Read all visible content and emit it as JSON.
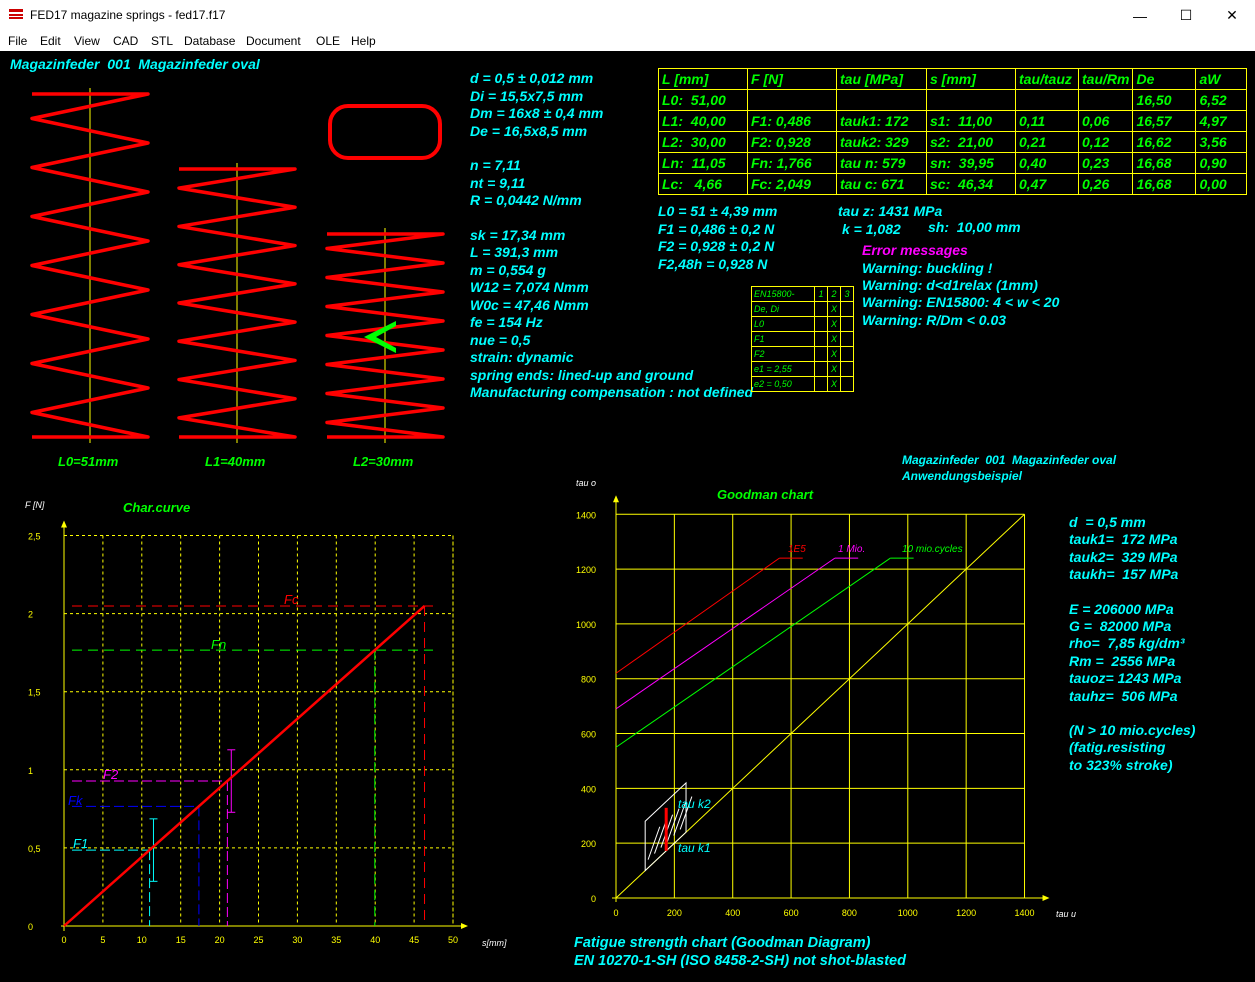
{
  "window": {
    "title": "FED17  magazine springs  -  fed17.f17",
    "minimize_glyph": "—",
    "maximize_glyph": "☐",
    "close_glyph": "✕"
  },
  "menu": {
    "items": [
      "File",
      "Edit",
      "View",
      "CAD",
      "STL",
      "Database",
      "Document",
      "OLE",
      "Help"
    ]
  },
  "header": {
    "spring_name": "Magazinfeder  001  Magazinfeder oval"
  },
  "spring_views": {
    "labels": [
      "L0=51mm",
      "L1=40mm",
      "L2=30mm"
    ]
  },
  "params_left": [
    "d = 0,5 ± 0,012 mm",
    "Di = 15,5x7,5 mm",
    "Dm = 16x8 ± 0,4 mm",
    "De = 16,5x8,5 mm",
    "",
    "n = 7,11",
    "nt = 9,11",
    "R = 0,0442 N/mm",
    "",
    "sk = 17,34 mm",
    "L = 391,3 mm",
    "m = 0,554 g",
    "W12 = 7,074 Nmm",
    "W0c = 47,46 Nmm",
    "fe = 154 Hz",
    "nue = 0,5",
    "strain: dynamic",
    "spring ends: lined-up and ground",
    "Manufacturing compensation : not defined"
  ],
  "results_table": {
    "headers": [
      "L [mm]",
      "F [N]",
      "tau [MPa]",
      "s [mm]",
      "tau/tauz",
      "tau/Rm",
      "De",
      "aW"
    ],
    "rows": [
      [
        "L0:  51,00",
        "",
        "",
        "",
        "",
        "",
        "16,50",
        "6,52"
      ],
      [
        "L1:  40,00",
        "F1: 0,486",
        "tauk1: 172",
        "s1:  11,00",
        "0,11",
        "0,06",
        "16,57",
        "4,97"
      ],
      [
        "L2:  30,00",
        "F2: 0,928",
        "tauk2: 329",
        "s2:  21,00",
        "0,21",
        "0,12",
        "16,62",
        "3,56"
      ],
      [
        "Ln:  11,05",
        "Fn: 1,766",
        "tau n: 579",
        "sn:  39,95",
        "0,40",
        "0,23",
        "16,68",
        "0,90"
      ],
      [
        "Lc:   4,66",
        "Fc: 2,049",
        "tau c: 671",
        "sc:  46,34",
        "0,47",
        "0,26",
        "16,68",
        "0,00"
      ]
    ]
  },
  "tolerances": {
    "l0": "L0 = 51 ± 4,39 mm",
    "f1": "F1 = 0,486 ± 0,2 N",
    "f2": "F2 = 0,928 ± 0,2 N",
    "f248": "F2,48h = 0,928 N",
    "tauz": "tau z: 1431 MPa",
    "k": "k = 1,082",
    "sh": "sh:  10,00 mm"
  },
  "en15800": {
    "header": [
      "EN15800-",
      "1",
      "2",
      "3"
    ],
    "rows": [
      [
        "De, Di",
        "",
        "X",
        ""
      ],
      [
        "L0",
        "",
        "X",
        ""
      ],
      [
        "F1",
        "",
        "X",
        ""
      ],
      [
        "F2",
        "",
        "X",
        ""
      ],
      [
        "e1 = 2,55",
        "",
        "X",
        ""
      ],
      [
        "e2 = 0,50",
        "",
        "X",
        ""
      ]
    ]
  },
  "errors": {
    "title": "Error messages",
    "items": [
      "Warning: buckling !",
      "Warning: d<d1relax (1mm)",
      "Warning: EN15800: 4 < w < 20",
      "Warning: R/Dm < 0.03"
    ]
  },
  "char_curve": {
    "title": "Char.curve",
    "ylabel": "F [N]",
    "xlabel": "s[mm]",
    "xticks": [
      "0",
      "5",
      "10",
      "15",
      "20",
      "25",
      "30",
      "35",
      "40",
      "45",
      "50"
    ],
    "yticks": [
      "0",
      "0,5",
      "1",
      "1,5",
      "2",
      "2,5"
    ],
    "labels": {
      "fc": "Fc",
      "fn": "Fn",
      "f2": "F2",
      "fk": "Fk",
      "f1": "F1"
    }
  },
  "chart_data": [
    {
      "type": "line",
      "title": "Char.curve",
      "xlabel": "s[mm]",
      "ylabel": "F [N]",
      "xlim": [
        0,
        50
      ],
      "ylim": [
        0,
        2.5
      ],
      "series": [
        {
          "values": [
            [
              0,
              0
            ],
            [
              46.34,
              2.049
            ]
          ]
        }
      ],
      "markers": {
        "F1": [
          11.0,
          0.486
        ],
        "F2": [
          21.0,
          0.928
        ],
        "Fk": [
          17.34,
          0.766
        ],
        "Fn": [
          39.95,
          1.766
        ],
        "Fc": [
          46.34,
          2.049
        ]
      },
      "tolerance_bars": {
        "F1": [
          11.0,
          0.286,
          0.686
        ],
        "F2": [
          21.0,
          0.728,
          1.128
        ]
      }
    },
    {
      "type": "line",
      "title": "Goodman chart",
      "xlabel": "tau u",
      "ylabel": "tau o",
      "xlim": [
        0,
        1400
      ],
      "ylim": [
        0,
        1400
      ],
      "series": [
        {
          "name": "1E5",
          "values": [
            [
              0,
              820
            ],
            [
              560,
              1240
            ]
          ]
        },
        {
          "name": "1 Mio.",
          "values": [
            [
              0,
              690
            ],
            [
              750,
              1240
            ]
          ]
        },
        {
          "name": "10 mio.cycles",
          "values": [
            [
              0,
              550
            ],
            [
              940,
              1240
            ]
          ]
        },
        {
          "values": [
            [
              0,
              0
            ],
            [
              1400,
              1400
            ]
          ]
        }
      ],
      "working_range": {
        "tau_k1": 172,
        "tau_k2": 329
      }
    }
  ],
  "goodman": {
    "title": "Goodman chart",
    "ylabel": "tau o",
    "xlabel": "tau u",
    "ticks": [
      "0",
      "200",
      "400",
      "600",
      "800",
      "1000",
      "1200",
      "1400"
    ],
    "line_labels": [
      "1E5",
      "1 Mio.",
      "10 mio.cycles"
    ],
    "tauk2": "tau k2",
    "tauk1": "tau k1",
    "subtitle1": "Magazinfeder  001  Magazinfeder oval",
    "subtitle2": "Anwendungsbeispiel",
    "footer1": "Fatigue strength chart (Goodman Diagram)",
    "footer2": "EN 10270-1-SH (ISO 8458-2-SH) not shot-blasted"
  },
  "material": [
    "d  = 0,5 mm",
    "tauk1=  172 MPa",
    "tauk2=  329 MPa",
    "taukh=  157 MPa",
    "",
    "E = 206000 MPa",
    "G =  82000 MPa",
    "rho=  7,85 kg/dm³",
    "Rm =  2556 MPa",
    "tauoz= 1243 MPa",
    "tauhz=  506 MPa",
    "",
    "(N > 10 mio.cycles)",
    "(fatig.resisting",
    "to 323% stroke)"
  ],
  "colors": {
    "background": "#000000",
    "cyan": "#00ffff",
    "green": "#00ff00",
    "yellow": "#ffff00",
    "red": "#ff0000",
    "magenta": "#ff00ff",
    "blue": "#0000ff"
  }
}
